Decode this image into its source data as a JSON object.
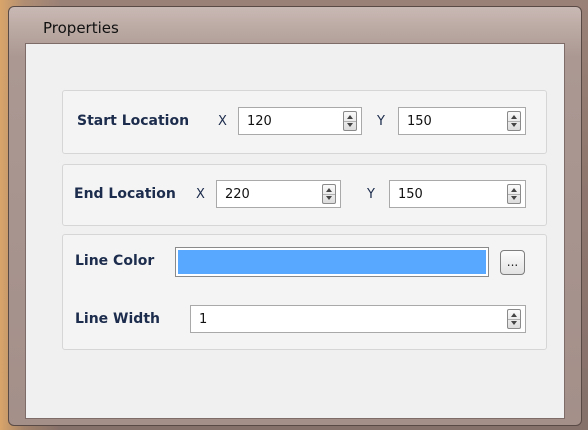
{
  "window": {
    "title": "Properties"
  },
  "start_location": {
    "label": "Start Location",
    "x_label": "X",
    "x_value": "120",
    "y_label": "Y",
    "y_value": "150"
  },
  "end_location": {
    "label": "End Location",
    "x_label": "X",
    "x_value": "220",
    "y_label": "Y",
    "y_value": "150"
  },
  "line_color": {
    "label": "Line Color",
    "value_hex": "#59a8ff",
    "button_label": "..."
  },
  "line_width": {
    "label": "Line Width",
    "value": "1"
  }
}
